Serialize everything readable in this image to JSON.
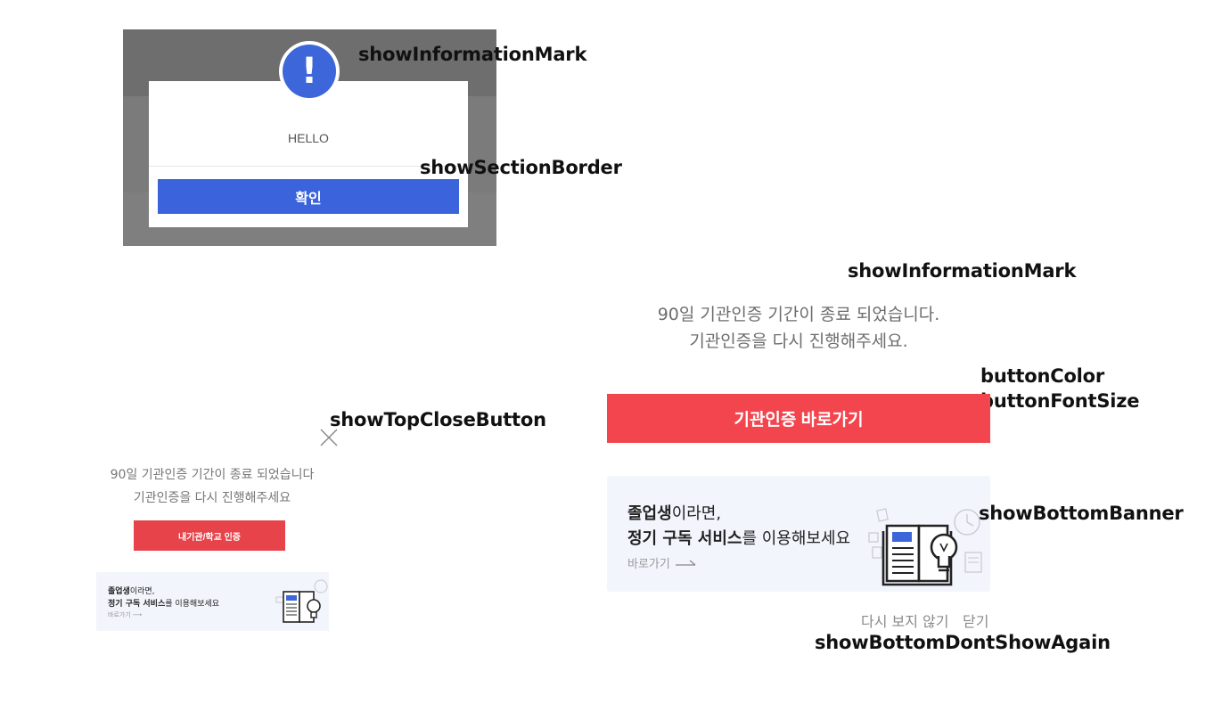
{
  "annotations": {
    "top_info_mark": "showInformationMark",
    "section_border": "showSectionBorder",
    "right_info_mark": "showInformationMark",
    "button_color": "buttonColor",
    "button_font_size": "buttonFontSize",
    "top_close_button": "showTopCloseButton",
    "bottom_banner": "showBottomBanner",
    "dont_show_again": "showBottomDontShowAgain"
  },
  "modal": {
    "info_mark": "!",
    "message": "HELLO",
    "confirm_label": "확인",
    "accent_color": "#3b63dc"
  },
  "small_popup": {
    "message_line1": "90일 기관인증 기간이 종료 되었습니다",
    "message_line2": "기관인증을 다시 진행해주세요",
    "button_label": "내기관/학교 인증",
    "banner": {
      "line1_bold": "졸업생",
      "line1_rest": "이라면,",
      "line2_bold": "정기 구독 서비스",
      "line2_rest": "를 이용해보세요",
      "link": "바로가기"
    },
    "button_color": "#e6434a"
  },
  "large_popup": {
    "message_line1": "90일 기관인증 기간이 종료 되었습니다.",
    "message_line2": "기관인증을 다시 진행해주세요.",
    "button_label": "기관인증 바로가기",
    "banner": {
      "line1_bold": "졸업생",
      "line1_rest": "이라면,",
      "line2_bold": "정기 구독 서비스",
      "line2_rest": "를 이용해보세요",
      "link": "바로가기"
    },
    "dont_show_again": "다시 보지 않기",
    "close_label": "닫기",
    "button_color": "#f2454d"
  }
}
